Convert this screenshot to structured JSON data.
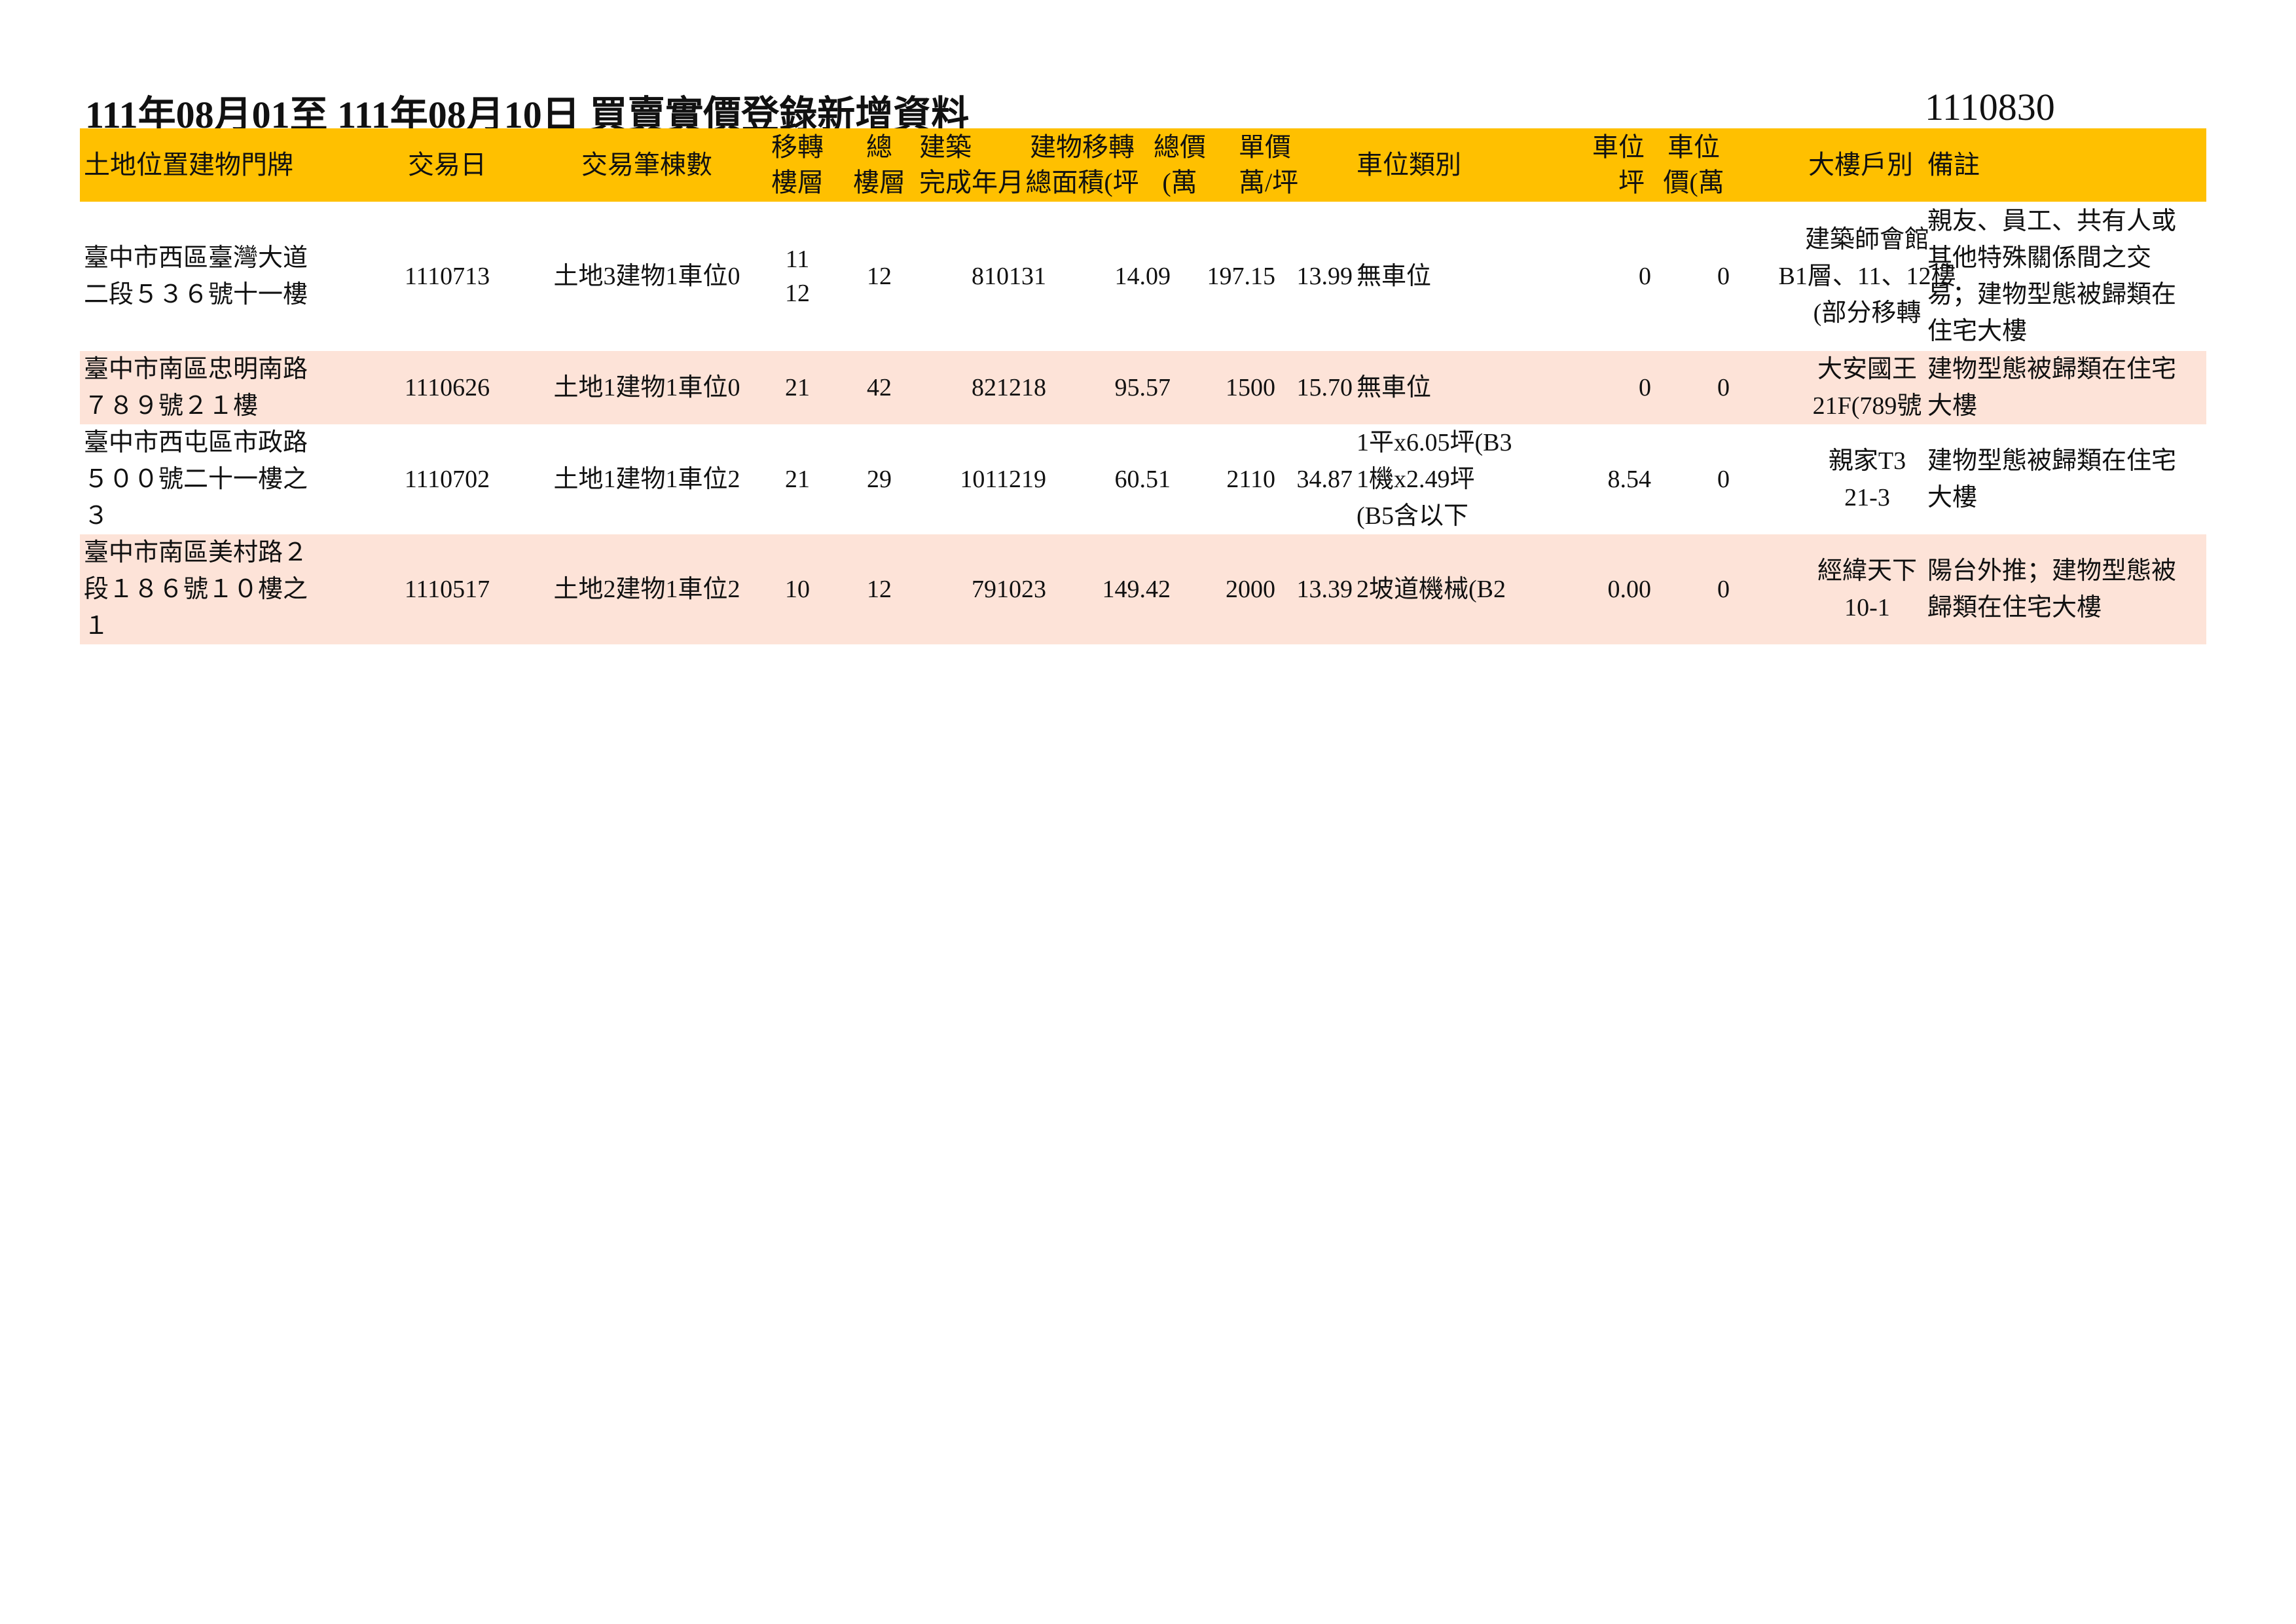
{
  "doc": {
    "title": "111年08月01至 111年08月10日  買賣實價登錄新增資料",
    "doc_no": "1110830"
  },
  "header": {
    "address": "土地位置建物門牌",
    "date": "交易日",
    "count": "交易筆棟數",
    "floor": "移轉\n樓層",
    "total_floors": "總\n樓層",
    "year": "建築\n完成年月",
    "area": "建物移轉\n總面積(坪",
    "price": "總價\n(萬",
    "unit_price": "單價\n萬/坪",
    "parking_type": "車位類別",
    "parking_area": "車位\n坪",
    "parking_price": "車位\n價(萬",
    "building": "大樓戶別",
    "note": "備註"
  },
  "rows": [
    {
      "address": "臺中市西區臺灣大道\n二段５３６號十一樓",
      "date": "1110713",
      "count": "土地3建物1車位0",
      "floor": "11\n12",
      "total_floors": "12",
      "year": "810131",
      "area": "14.09",
      "price": "197.15",
      "unit_price": "13.99",
      "parking_type": "無車位",
      "parking_area": "0",
      "parking_price": "0",
      "building": "建築師會館\nB1層、11、12樓\n(部分移轉",
      "note": "親友、員工、共有人或\n其他特殊關係間之交\n易；建物型態被歸類在\n住宅大樓"
    },
    {
      "address": "臺中市南區忠明南路\n７８９號２１樓",
      "date": "1110626",
      "count": "土地1建物1車位0",
      "floor": "21",
      "total_floors": "42",
      "year": "821218",
      "area": "95.57",
      "price": "1500",
      "unit_price": "15.70",
      "parking_type": "無車位",
      "parking_area": "0",
      "parking_price": "0",
      "building": "大安國王\n21F(789號",
      "note": "建物型態被歸類在住宅\n大樓"
    },
    {
      "address": "臺中市西屯區市政路\n５００號二十一樓之\n３",
      "date": "1110702",
      "count": "土地1建物1車位2",
      "floor": "21",
      "total_floors": "29",
      "year": "1011219",
      "area": "60.51",
      "price": "2110",
      "unit_price": "34.87",
      "parking_type": "1平x6.05坪(B3\n1機x2.49坪\n(B5含以下",
      "parking_area": "8.54",
      "parking_price": "0",
      "building": "親家T3\n21-3",
      "note": "建物型態被歸類在住宅\n大樓"
    },
    {
      "address": "臺中市南區美村路２\n段１８６號１０樓之\n１",
      "date": "1110517",
      "count": "土地2建物1車位2",
      "floor": "10",
      "total_floors": "12",
      "year": "791023",
      "area": "149.42",
      "price": "2000",
      "unit_price": "13.39",
      "parking_type": "2坡道機械(B2",
      "parking_area": "0.00",
      "parking_price": "0",
      "building": "經緯天下\n10-1",
      "note": "陽台外推；建物型態被\n歸類在住宅大樓"
    }
  ],
  "colors": {
    "header_bg": "#ffc000",
    "alt_row_bg": "#fde3d8"
  }
}
